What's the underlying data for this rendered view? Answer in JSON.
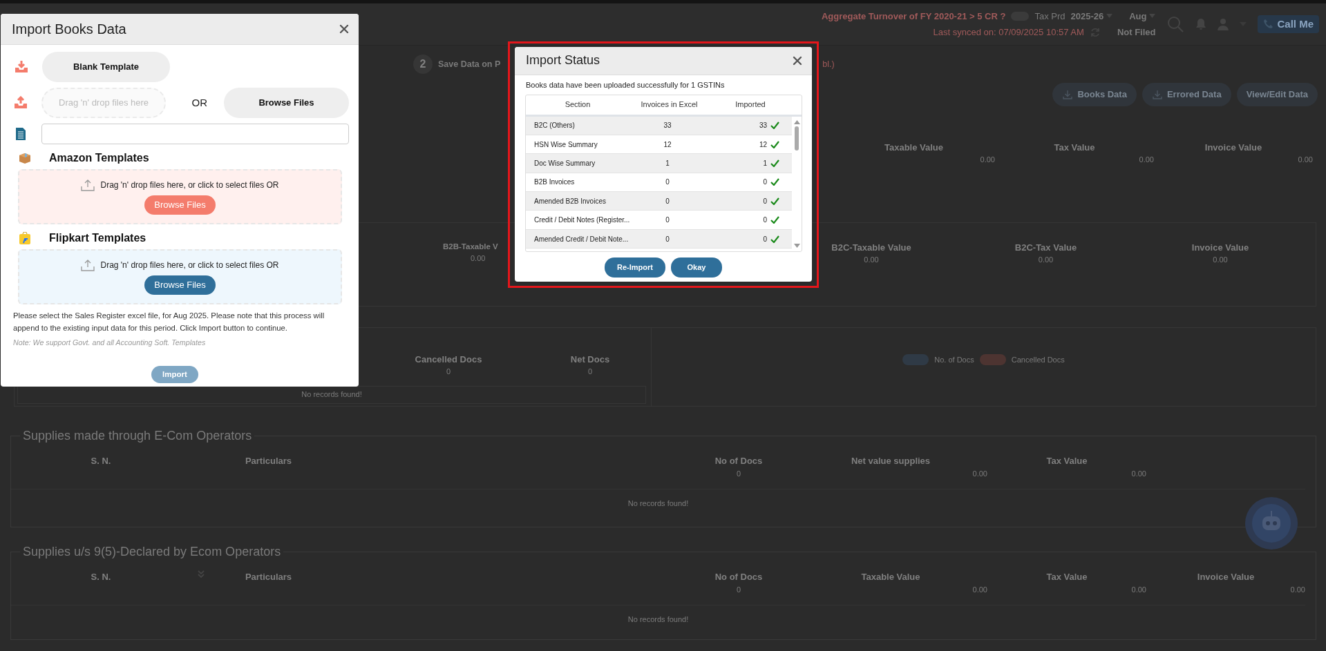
{
  "header": {
    "turnover_question": "Aggregate Turnover of FY 2020-21 > 5 CR ?",
    "turnover_toggle": {
      "on": false
    },
    "tax_period_label": "Tax Prd",
    "year": "2025-26",
    "month": "Aug",
    "call_button": "Call Me",
    "last_synced": "Last synced on: 07/09/2025 10:57 AM",
    "filing_status": "Not Filed"
  },
  "step": {
    "number": "2",
    "label": "Save Data on P",
    "fragment": "bl.)"
  },
  "actions": [
    {
      "label": "Books Data",
      "kind": "download"
    },
    {
      "label": "Errored Data",
      "kind": "download"
    },
    {
      "label": "View/Edit Data",
      "kind": "plain"
    }
  ],
  "summary": [
    {
      "label": "Taxable Value",
      "value": "0.00"
    },
    {
      "label": "Tax Value",
      "value": "0.00"
    },
    {
      "label": "Invoice Value",
      "value": "0.00"
    }
  ],
  "b2b_b2c_panel": [
    {
      "label": "B2B-Taxable V",
      "value": "0.00"
    },
    {
      "label": "B2C-Taxable Value",
      "value": "0.00"
    },
    {
      "label": "B2C-Tax Value",
      "value": "0.00"
    },
    {
      "label": "Invoice Value",
      "value": "0.00"
    }
  ],
  "docs_panel": {
    "metrics": [
      {
        "label": "Cancelled Docs",
        "value": "0"
      },
      {
        "label": "Net Docs",
        "value": "0"
      }
    ],
    "empty_message": "No records found!",
    "legend": [
      {
        "label": "No. of Docs",
        "color": "#2f3a46"
      },
      {
        "label": "Cancelled Docs",
        "color": "#4d3431"
      }
    ]
  },
  "sections": [
    {
      "title": "Supplies made through E-Com Operators",
      "columns": [
        {
          "kind": "label",
          "label": "S. N."
        },
        {
          "kind": "label",
          "label": "Particulars"
        },
        {
          "kind": "label",
          "label": "No of Docs",
          "value": "0"
        },
        {
          "kind": "label",
          "label": "Net value supplies",
          "value": "0.00"
        },
        {
          "kind": "label",
          "label": "Tax Value",
          "value": "0.00"
        }
      ],
      "empty_message": "No records found!"
    },
    {
      "title": "Supplies u/s 9(5)-Declared by Ecom Operators",
      "columns": [
        {
          "kind": "label",
          "label": "S. N."
        },
        {
          "kind": "icon"
        },
        {
          "kind": "label",
          "label": "Particulars"
        },
        {
          "kind": "label",
          "label": "No of Docs",
          "value": "0"
        },
        {
          "kind": "label",
          "label": "Taxable Value",
          "value": "0.00"
        },
        {
          "kind": "label",
          "label": "Tax Value",
          "value": "0.00"
        },
        {
          "kind": "label",
          "label": "Invoice Value",
          "value": "0.00"
        }
      ],
      "empty_message": "No records found!"
    }
  ],
  "import_books_modal": {
    "title": "Import Books Data",
    "blank_template_button": "Blank Template",
    "drop_placeholder": "Drag 'n' drop files here",
    "or_label": "OR",
    "browse_button": "Browse Files",
    "marketplaces": [
      {
        "kind": "amazon",
        "title": "Amazon Templates",
        "drop_text": "Drag 'n' drop files here, or click to select files OR",
        "browse_button": "Browse Files"
      },
      {
        "kind": "flipkart",
        "title": "Flipkart Templates",
        "drop_text": "Drag 'n' drop files here, or click to select files OR",
        "browse_button": "Browse Files"
      }
    ],
    "instructions": "Please select the Sales Register excel file, for Aug 2025. Please note that this process will append to the existing input data for this period. Click Import button to continue.",
    "note": "Note: We support Govt. and all Accounting Soft. Templates",
    "import_button": {
      "label": "Import",
      "disabled": true
    }
  },
  "import_status_modal": {
    "title": "Import Status",
    "message": "Books data have been uploaded successfully for 1 GSTINs",
    "columns": [
      "Section",
      "Invoices in Excel",
      "Imported"
    ],
    "rows": [
      {
        "section": "B2C (Others)",
        "in_excel": "33",
        "imported": "33"
      },
      {
        "section": "HSN Wise Summary",
        "in_excel": "12",
        "imported": "12"
      },
      {
        "section": "Doc Wise Summary",
        "in_excel": "1",
        "imported": "1"
      },
      {
        "section": "B2B Invoices",
        "in_excel": "0",
        "imported": "0"
      },
      {
        "section": "Amended B2B Invoices",
        "in_excel": "0",
        "imported": "0"
      },
      {
        "section": "Credit / Debit Notes (Register...",
        "in_excel": "0",
        "imported": "0"
      },
      {
        "section": "Amended Credit / Debit Note...",
        "in_excel": "0",
        "imported": "0"
      }
    ],
    "buttons": [
      "Re-Import",
      "Okay"
    ]
  }
}
